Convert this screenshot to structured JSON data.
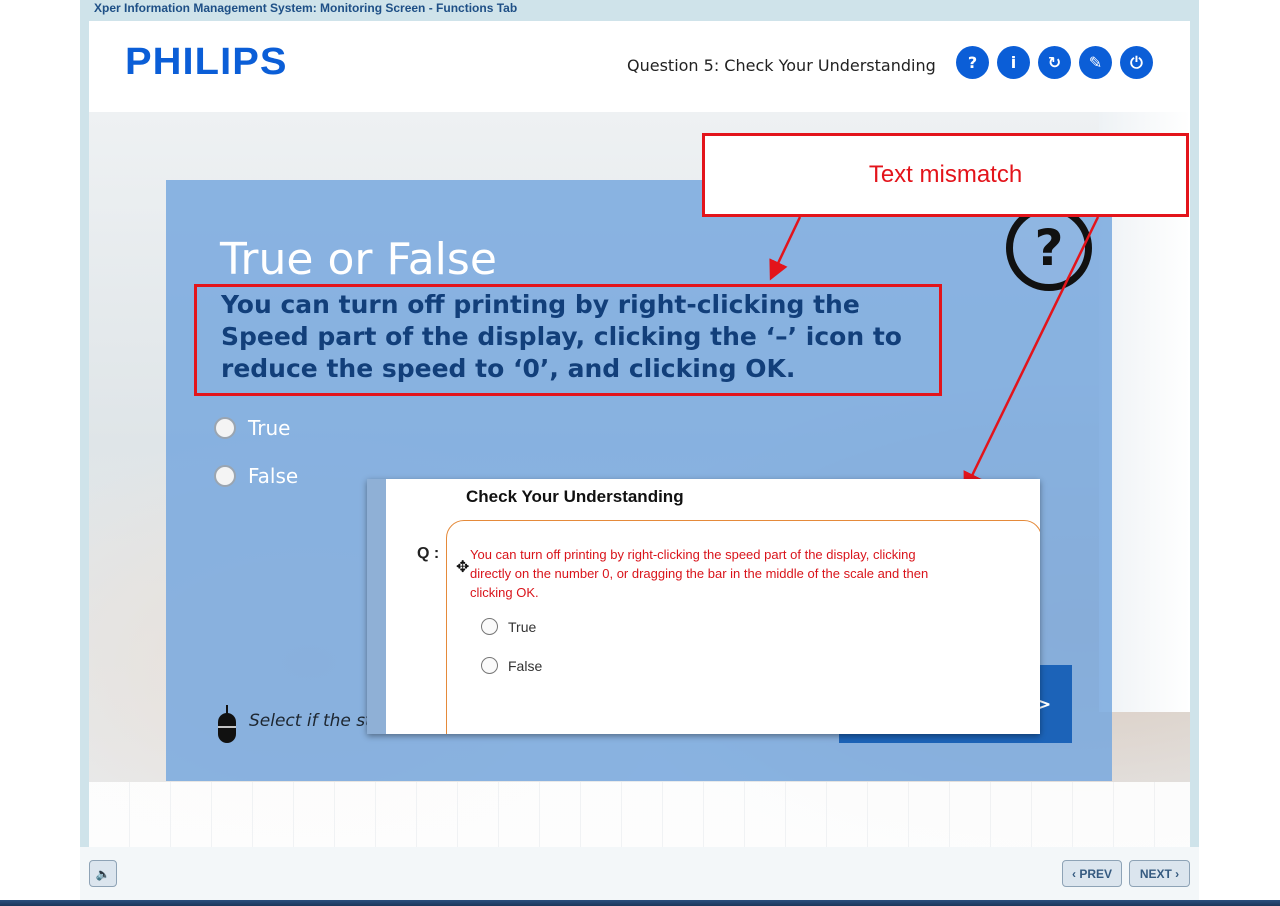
{
  "window": {
    "title": "Xper Information Management System: Monitoring Screen - Functions Tab"
  },
  "header": {
    "logo": "PHILIPS",
    "question_title": "Question 5: Check Your Understanding",
    "buttons": [
      {
        "name": "help",
        "glyph": "?"
      },
      {
        "name": "info",
        "glyph": "i"
      },
      {
        "name": "replay",
        "glyph": "↻"
      },
      {
        "name": "glossary",
        "glyph": "✎"
      },
      {
        "name": "exit",
        "glyph": "⏻"
      }
    ]
  },
  "panel": {
    "title": "True or False",
    "question": "You can turn off printing by right-clicking the Speed part of the display, clicking the ‘–’ icon to reduce the speed to ‘0’, and clicking OK.",
    "options": [
      "True",
      "False"
    ],
    "hint": "Select if the sto",
    "submit_glyph": ">"
  },
  "annotation": {
    "callout_text": "Text mismatch",
    "color": "#e3141b"
  },
  "reference": {
    "title": "Check Your Understanding",
    "q_label": "Q :",
    "question": "You can turn off printing by right-clicking the speed part of the display, clicking directly on the number 0, or dragging the bar in the middle of the scale and then clicking OK.",
    "options": [
      "True",
      "False"
    ]
  },
  "footer": {
    "sound_glyph": "🔈",
    "prev_label": "‹ PREV",
    "next_label": "NEXT ›"
  },
  "colors": {
    "brand": "#0b5ed7",
    "panel": "#78a8de",
    "question_text": "#123f7a",
    "mismatch": "#e3141b"
  }
}
